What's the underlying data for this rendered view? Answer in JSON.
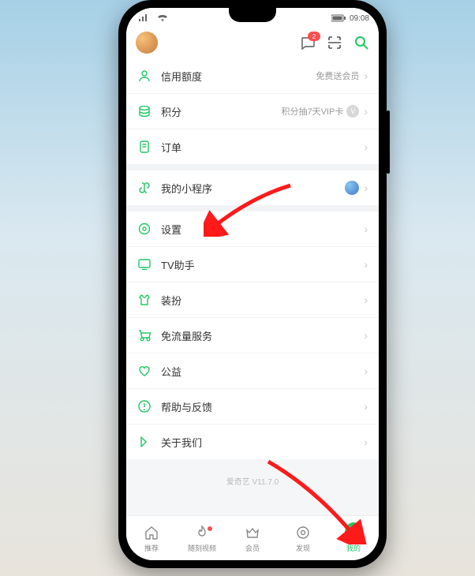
{
  "status": {
    "time": "09:08",
    "signal_icon": "signal-icon",
    "wifi_icon": "wifi-icon",
    "battery_icon": "battery-icon"
  },
  "header": {
    "message_badge": "2"
  },
  "rows": {
    "credit": {
      "label": "信用额度",
      "extra": "免费送会员"
    },
    "points": {
      "label": "积分",
      "extra": "积分抽7天VIP卡"
    },
    "orders": {
      "label": "订单"
    },
    "miniapp": {
      "label": "我的小程序"
    },
    "settings": {
      "label": "设置"
    },
    "tv": {
      "label": "TV助手"
    },
    "decor": {
      "label": "装扮"
    },
    "data": {
      "label": "免流量服务"
    },
    "charity": {
      "label": "公益"
    },
    "help": {
      "label": "帮助与反馈"
    },
    "about": {
      "label": "关于我们"
    }
  },
  "version": "爱奇艺 V11.7.0",
  "nav": {
    "recommend": "推荐",
    "moments": "随刻视频",
    "member": "会员",
    "discover": "发现",
    "mine": "我的"
  }
}
